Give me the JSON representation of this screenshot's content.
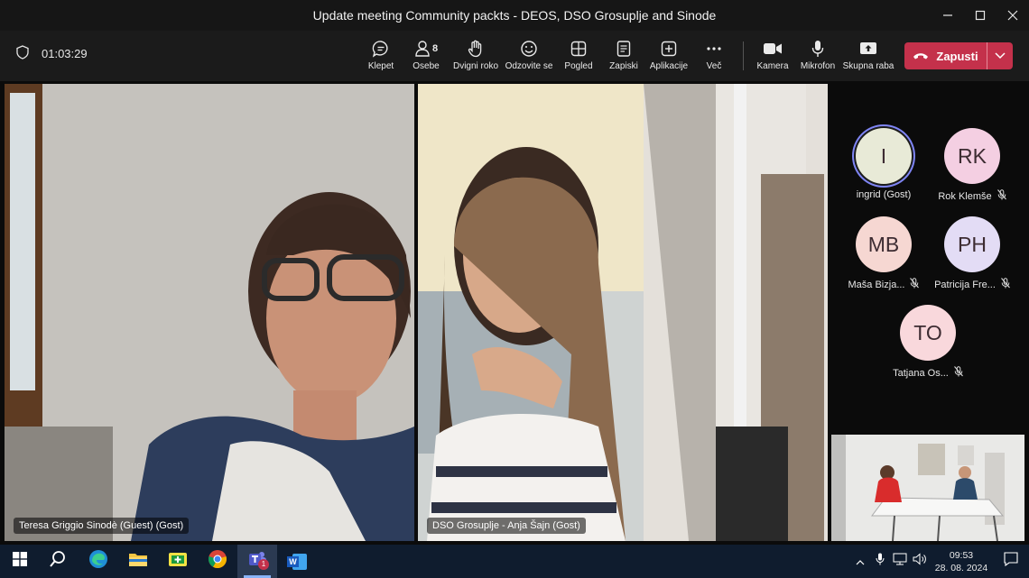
{
  "window": {
    "title": "Update meeting Community packts - DEOS, DSO Grosuplje and Sinode"
  },
  "toolbar": {
    "timer": "01:03:29",
    "chat_label": "Klepet",
    "people_label": "Osebe",
    "people_count": "8",
    "raise_label": "Dvigni roko",
    "react_label": "Odzovite se",
    "view_label": "Pogled",
    "notes_label": "Zapiski",
    "apps_label": "Aplikacije",
    "more_label": "Več",
    "camera_label": "Kamera",
    "mic_label": "Mikrofon",
    "share_label": "Skupna raba",
    "leave_label": "Zapusti"
  },
  "tiles": {
    "left_name": "Teresa Griggio Sinodè (Guest) (Gost)",
    "right_name": "DSO Grosuplje - Anja Šajn (Gost)"
  },
  "participants": [
    {
      "initials": "I",
      "name": "ingrid (Gost)",
      "muted": false,
      "color": "#e8ead7"
    },
    {
      "initials": "RK",
      "name": "Rok Klemše",
      "muted": true,
      "color": "#f4cfe2"
    },
    {
      "initials": "MB",
      "name": "Maša Bizja...",
      "muted": true,
      "color": "#f6d7d2"
    },
    {
      "initials": "PH",
      "name": "Patricija Fre...",
      "muted": true,
      "color": "#e3dcf5"
    },
    {
      "initials": "TO",
      "name": "Tatjana Os...",
      "muted": true,
      "color": "#f9d8dc"
    }
  ],
  "taskbar": {
    "time": "09:53",
    "date": "28. 08. 2024",
    "teams_badge": "1",
    "word_letter": "W"
  },
  "colors": {
    "leave": "#c4314b",
    "avatar_ring": "#7f85f5",
    "taskbar": "#0f1c2e"
  }
}
